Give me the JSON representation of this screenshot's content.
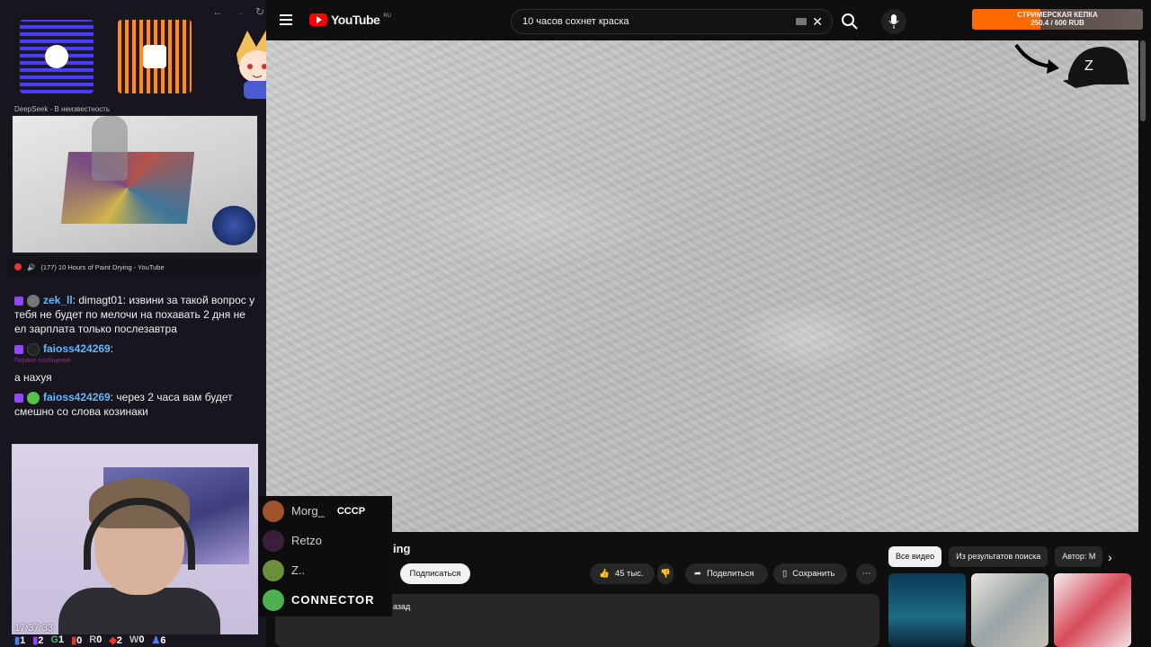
{
  "overlay": {
    "deepseek_label": "DeepSeek - В неизвестность",
    "media_tab_label": "(177) 10 Hours of Paint Drying - YouTube",
    "clock": "17:37:33",
    "stats": [
      {
        "icon": "user",
        "value": "1"
      },
      {
        "icon": "chat",
        "value": "2"
      },
      {
        "icon": "g",
        "value": "1"
      },
      {
        "icon": "yt",
        "value": "0"
      },
      {
        "icon": "b",
        "value": "0"
      },
      {
        "icon": "tg",
        "value": "2"
      },
      {
        "icon": "w",
        "value": "0"
      },
      {
        "icon": "people",
        "value": "6"
      }
    ]
  },
  "chat": [
    {
      "user": "zek_ll",
      "text": "dimagt01: извини за такой вопрос у тебя не будет по мелочи на похавать 2 дня не ел зарплата только послезавтра"
    },
    {
      "user": "faioss424269",
      "first_label": "Первое сообщение",
      "text": "а нахуя"
    },
    {
      "user": "faioss424269",
      "text": "через 2 часа вам будет смешно со слова козинаки"
    }
  ],
  "viewers": [
    {
      "name": "Morg_",
      "tag": "CCCP"
    },
    {
      "name": "Retzo"
    },
    {
      "name": "Z.."
    },
    {
      "name": "CONNECTOR"
    }
  ],
  "youtube": {
    "logo_text": "YouTube",
    "region": "RU",
    "search_value": "10 часов сохнет краска",
    "donation": {
      "title": "СТРИМЕРСКАЯ КЕПКА",
      "amount": "250.4 / 600 RUB",
      "progress_percent": 41.7
    },
    "title_fragment": "ing",
    "subscribe_label": "Подписаться",
    "like_count": "45 тыс.",
    "share_label": "Поделиться",
    "save_label": "Сохранить",
    "description_fragment": "азад",
    "chips": [
      "Все видео",
      "Из результатов поиска",
      "Автор: M"
    ]
  },
  "colors": {
    "accent": "#ff0000",
    "twitch_purple": "#9147ff",
    "donation_orange": "#ff6a00",
    "username_blue": "#5fb8ff"
  }
}
